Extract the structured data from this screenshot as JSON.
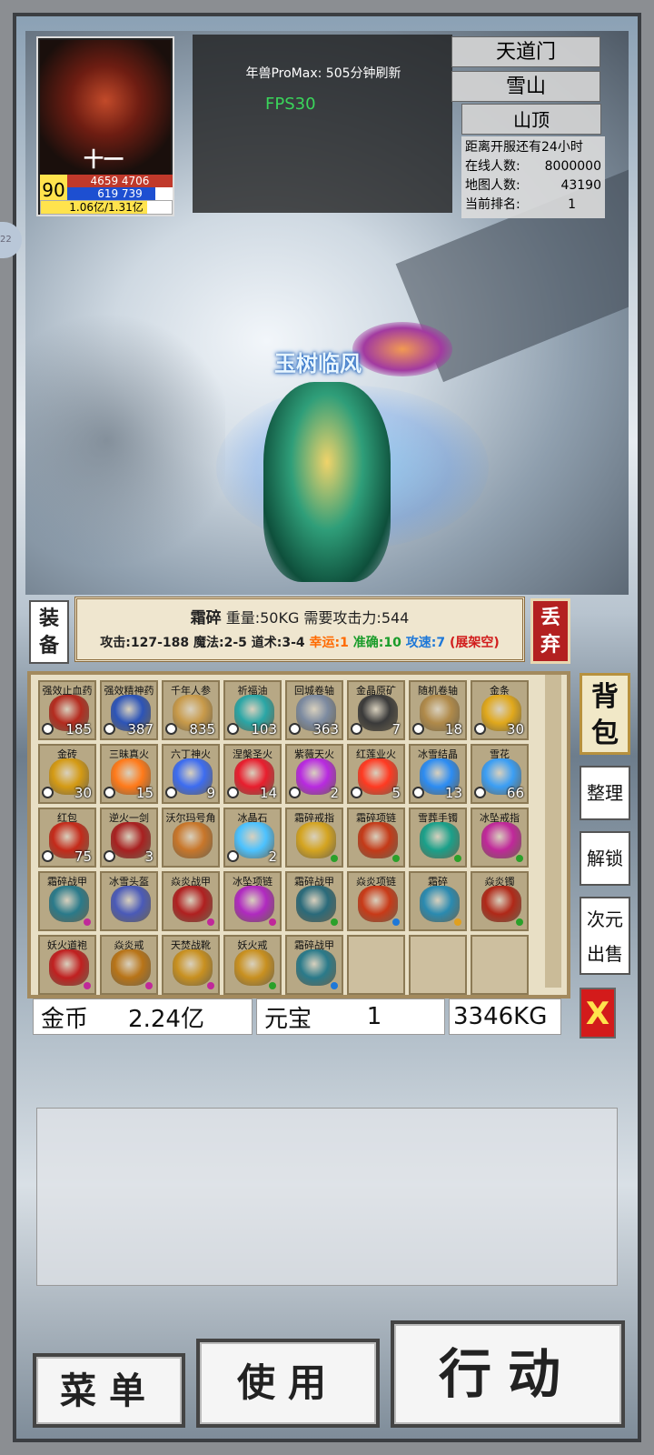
{
  "player": {
    "avatar_name": "十一",
    "level": "90",
    "hp_text": "4659 4706",
    "mp_text": "619 739",
    "mp_fraction": 0.84,
    "exp_text": "1.06亿/1.31亿",
    "exp_fraction": 0.81,
    "character_name": "玉树临风"
  },
  "hud": {
    "notice": "年兽ProMax: 505分钟刷新",
    "fps": "FPS30",
    "edge_tab": "22"
  },
  "location": {
    "sect": "天道门",
    "map": "雪山",
    "area": "山顶"
  },
  "server": {
    "countdown": "距离开服还有24小时",
    "online_label": "在线人数:",
    "online_value": "8000000",
    "map_label": "地图人数:",
    "map_value": "43190",
    "rank_label": "当前排名:",
    "rank_value": "1"
  },
  "item_info": {
    "name": "霜碎",
    "weight_req": "重量:50KG 需要攻击力:544",
    "attack": "攻击:127-188",
    "magic": "魔法:2-5",
    "tao": "道术:3-4",
    "luck": "幸运:1",
    "accuracy": "准确:10",
    "speed": "攻速:7",
    "stall": "(展架空)"
  },
  "buttons": {
    "equip": "装备",
    "drop": "丢弃",
    "bag": "背包",
    "sort": "整理",
    "unlock": "解锁",
    "sell": "次元出售",
    "close": "X",
    "menu": "菜单",
    "use": "使用",
    "action": "行动"
  },
  "inventory": [
    {
      "name": "强效止血药",
      "count": "185",
      "color": "#b42b1f",
      "dot": ""
    },
    {
      "name": "强效精神药",
      "count": "387",
      "color": "#2c54b8",
      "dot": ""
    },
    {
      "name": "千年人参",
      "count": "835",
      "color": "#c89a4a",
      "dot": ""
    },
    {
      "name": "祈福油",
      "count": "103",
      "color": "#2aa6a6",
      "dot": ""
    },
    {
      "name": "回城卷轴",
      "count": "363",
      "color": "#7c8aa0",
      "dot": ""
    },
    {
      "name": "金晶原矿",
      "count": "7",
      "color": "#3a3a3a",
      "dot": ""
    },
    {
      "name": "随机卷轴",
      "count": "18",
      "color": "#b08a4a",
      "dot": ""
    },
    {
      "name": "金条",
      "count": "30",
      "color": "#e0a81c",
      "dot": ""
    },
    {
      "name": "金砖",
      "count": "30",
      "color": "#d49a14",
      "dot": ""
    },
    {
      "name": "三昧真火",
      "count": "15",
      "color": "#ff7a1a",
      "dot": ""
    },
    {
      "name": "六丁神火",
      "count": "9",
      "color": "#3d6cf0",
      "dot": ""
    },
    {
      "name": "涅槃圣火",
      "count": "14",
      "color": "#e81e2e",
      "dot": ""
    },
    {
      "name": "紫薇天火",
      "count": "2",
      "color": "#b82ae0",
      "dot": ""
    },
    {
      "name": "红莲业火",
      "count": "5",
      "color": "#ff3a22",
      "dot": ""
    },
    {
      "name": "冰雪结晶",
      "count": "13",
      "color": "#2c8cf2",
      "dot": ""
    },
    {
      "name": "雪花",
      "count": "66",
      "color": "#3b9ef4",
      "dot": ""
    },
    {
      "name": "红包",
      "count": "75",
      "color": "#c42a1a",
      "dot": ""
    },
    {
      "name": "逆火一剑",
      "count": "3",
      "color": "#a82020",
      "dot": ""
    },
    {
      "name": "沃尔玛号角",
      "count": "",
      "color": "#c8762a",
      "dot": ""
    },
    {
      "name": "冰晶石",
      "count": "2",
      "color": "#4cc2ff",
      "dot": ""
    },
    {
      "name": "霜碎戒指",
      "count": "",
      "color": "#d4a420",
      "dot": "#2aa02a"
    },
    {
      "name": "霜碎项链",
      "count": "",
      "color": "#c43a18",
      "dot": "#2aa02a"
    },
    {
      "name": "雪葬手镯",
      "count": "",
      "color": "#1aa08a",
      "dot": "#2aa02a"
    },
    {
      "name": "冰坠戒指",
      "count": "",
      "color": "#c0289a",
      "dot": "#2aa02a"
    },
    {
      "name": "霜碎战甲",
      "count": "",
      "color": "#2a7a8a",
      "dot": "#c0289a"
    },
    {
      "name": "冰雪头盔",
      "count": "",
      "color": "#4a5ab8",
      "dot": ""
    },
    {
      "name": "焱炎战甲",
      "count": "",
      "color": "#b02020",
      "dot": "#c0289a"
    },
    {
      "name": "冰坠项链",
      "count": "",
      "color": "#b02ac0",
      "dot": "#c0289a"
    },
    {
      "name": "霜碎战甲",
      "count": "",
      "color": "#2a6a7a",
      "dot": "#2aa02a"
    },
    {
      "name": "焱炎项链",
      "count": "",
      "color": "#c83a18",
      "dot": "#1e78d8"
    },
    {
      "name": "霜碎",
      "count": "",
      "color": "#2a8ab0",
      "dot": "#e0a020"
    },
    {
      "name": "焱炎镯",
      "count": "",
      "color": "#b02818",
      "dot": "#2aa02a"
    },
    {
      "name": "妖火道袍",
      "count": "",
      "color": "#c02020",
      "dot": "#c0289a"
    },
    {
      "name": "焱炎戒",
      "count": "",
      "color": "#b87418",
      "dot": "#c0289a"
    },
    {
      "name": "天焚战靴",
      "count": "",
      "color": "#c89020",
      "dot": "#c0289a"
    },
    {
      "name": "妖火戒",
      "count": "",
      "color": "#c89020",
      "dot": "#2aa02a"
    },
    {
      "name": "霜碎战甲",
      "count": "",
      "color": "#2a7a8a",
      "dot": "#1e78d8"
    }
  ],
  "empty_slots": 3,
  "currency": {
    "gold_label": "金币",
    "gold_value": "2.24亿",
    "yuanbao_label": "元宝",
    "yuanbao_value": "1",
    "weight": "3346KG"
  }
}
